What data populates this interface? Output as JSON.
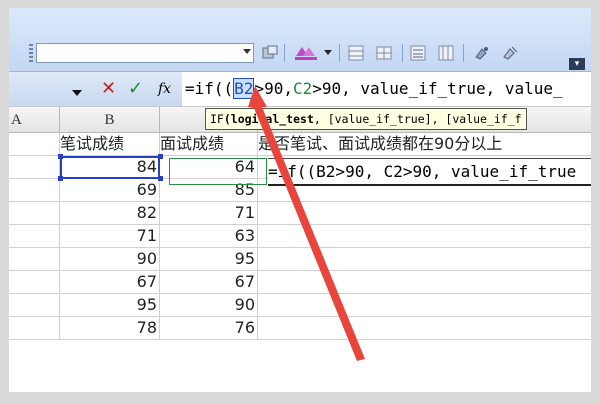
{
  "toolbar": {
    "font_name_value": "",
    "icons": [
      "grip-icon",
      "font-dropdown-arrow-icon",
      "copy-format-icon",
      "highlight-color-icon",
      "dropdown-arrow-icon",
      "borders-icon",
      "merge-icon",
      "align-icon",
      "table-icon",
      "format-painter-icon",
      "clear-format-icon",
      "toolbar-options-icon"
    ]
  },
  "formula_bar": {
    "cancel_icon": "✕",
    "enter_icon": "✓",
    "fx_label": "fx",
    "formula_prefix": "=if((",
    "formula_ref_b": "B2",
    "formula_mid": ">90,",
    "formula_ref_c": "C2",
    "formula_rest": ">90, value_if_true, value_"
  },
  "tooltip": {
    "func": "IF",
    "arg1": "(logical_test",
    "rest": ", [value_if_true], [value_if_f"
  },
  "columns": [
    "A",
    "B"
  ],
  "headers": {
    "b": "笔试成绩",
    "c": "面试成绩",
    "d": "是否笔试、面试成绩都在90分以上"
  },
  "rows": [
    {
      "b": "84",
      "c": "64"
    },
    {
      "b": "69",
      "c": "85"
    },
    {
      "b": "82",
      "c": "71"
    },
    {
      "b": "71",
      "c": "63"
    },
    {
      "b": "90",
      "c": "95"
    },
    {
      "b": "67",
      "c": "67"
    },
    {
      "b": "95",
      "c": "90"
    },
    {
      "b": "78",
      "c": "76"
    }
  ],
  "editing_cell": {
    "text": "=if((B2>90, C2>90, value_if_true"
  },
  "colors": {
    "arrow": "#e8453c",
    "selection": "#2a3fbf",
    "range_c": "#2e8b44",
    "tooltip_bg": "#ffffe1"
  }
}
